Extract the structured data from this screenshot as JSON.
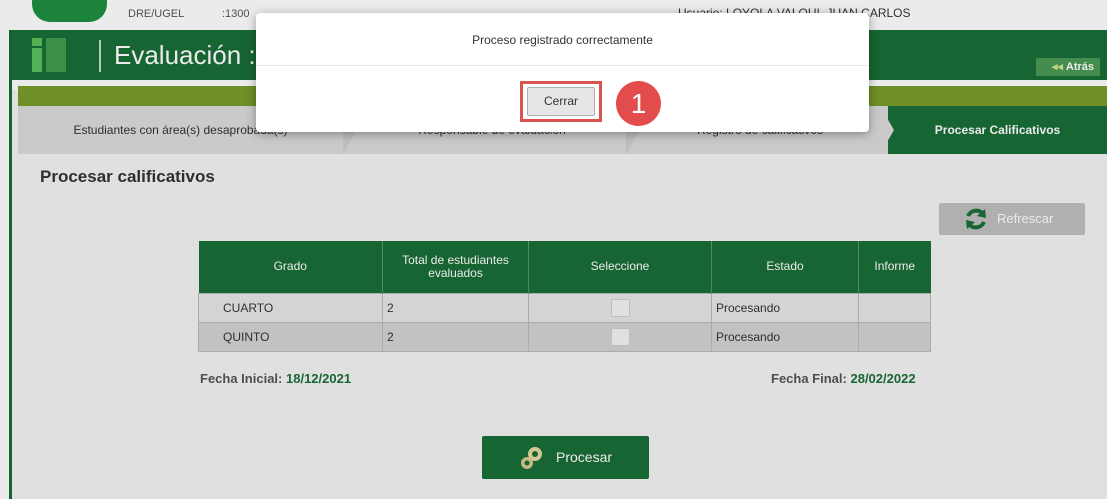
{
  "topbar": {
    "dre_label": "DRE/UGEL",
    "code": ":1300",
    "user": "Usuario: LOYOLA VALQUI, JUAN CARLOS"
  },
  "header": {
    "title": "Evaluación :",
    "back_label": "Atrás",
    "back_arrows": "◂◂"
  },
  "tabs": [
    {
      "label": "Estudiantes con área(s) desaprobada(s)"
    },
    {
      "label": "Responsable de evaluación"
    },
    {
      "label": "Registro de calificativos"
    },
    {
      "label": "Procesar Calificativos",
      "active": true
    }
  ],
  "main": {
    "section_title": "Procesar calificativos",
    "refresh_label": "Refrescar",
    "table": {
      "headers": [
        "Grado",
        "Total de estudiantes evaluados",
        "Seleccione",
        "Estado",
        "Informe"
      ],
      "rows": [
        {
          "grado": "CUARTO",
          "total": "2",
          "estado": "Procesando",
          "informe": ""
        },
        {
          "grado": "QUINTO",
          "total": "2",
          "estado": "Procesando",
          "informe": ""
        }
      ]
    },
    "fecha_inicial_label": "Fecha Inicial:",
    "fecha_inicial_value": "18/12/2021",
    "fecha_final_label": "Fecha Final:",
    "fecha_final_value": "28/02/2022",
    "procesar_label": "Procesar"
  },
  "modal": {
    "message": "Proceso registrado correctamente",
    "close_label": "Cerrar",
    "step_number": "1"
  },
  "colors": {
    "primary_green": "#1a6e38",
    "olive": "#7a9c2a",
    "highlight_red": "#d9534f",
    "badge_red": "#e34c4c",
    "status_blue": "#2222bb"
  }
}
